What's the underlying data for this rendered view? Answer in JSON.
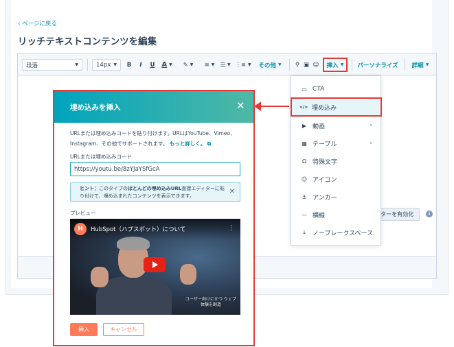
{
  "header": {
    "back_link": "‹ ページに戻る",
    "page_title": "リッチテキストコンテンツを編集"
  },
  "toolbar": {
    "paragraph_select": "段落",
    "font_size_select": "14px",
    "bold": "B",
    "italic": "I",
    "underline": "U",
    "text_color": "A",
    "highlight": "✎",
    "align": "≡",
    "bullet_list": "☰",
    "numbered_list": "⋮≡",
    "more_label": "その他",
    "link_icon": "⚲",
    "image_icon": "▣",
    "emoji_icon": "☺",
    "insert_label": "挿入",
    "personalize_label": "パーソナライズ",
    "details_label": "詳細"
  },
  "insert_menu": {
    "items": [
      {
        "label": "CTA",
        "icon": "cta-icon",
        "glyph": "▭"
      },
      {
        "label": "埋め込み",
        "icon": "embed-icon",
        "glyph": "</>"
      },
      {
        "label": "動画",
        "icon": "video-icon",
        "glyph": "▶"
      },
      {
        "label": "テーブル",
        "icon": "table-icon",
        "glyph": "▦"
      },
      {
        "label": "特殊文字",
        "icon": "omega-icon",
        "glyph": "Ω"
      },
      {
        "label": "アイコン",
        "icon": "emoji-icon",
        "glyph": "☺"
      },
      {
        "label": "アンカー",
        "icon": "anchor-icon",
        "glyph": "⚓"
      },
      {
        "label": "横線",
        "icon": "horizontal-rule-icon",
        "glyph": "—"
      },
      {
        "label": "ノーブレークスペース",
        "icon": "nbsp-icon",
        "glyph": "⤓"
      }
    ]
  },
  "editor_footer": {
    "dark_editor_button": "ダークエディターを有効化",
    "info_icon": "i"
  },
  "modal": {
    "title": "埋め込みを挿入",
    "close_icon": "✕",
    "description": "URLまたは埋め込みコードを貼り付けます。URLはYouTube、Vimeo、Instagram、その他でサポートされます。",
    "learn_more": "もっと詳しく。",
    "external_icon": "⧉",
    "url_label": "URLまたは埋め込みコード",
    "url_value": "https://youtu.be/8zYJaYSfGcA",
    "hint_prefix": "ヒント：",
    "hint_middle": "このタイプの",
    "hint_bold": "ほとんどの埋め込みURL",
    "hint_rest": "直接エディターに貼り付けて、埋め込まれたコンテンツを表示できます。",
    "hint_close": "✕",
    "preview_label": "プレビュー",
    "video": {
      "logo": "H",
      "title": "HubSpot（ハブスポット）について",
      "kebab": "⋮",
      "subtitle": "ユーザー向けにかつ ウェブ体験を創造"
    },
    "insert_button": "挿入",
    "cancel_button": "キャンセル"
  },
  "colors": {
    "accent_teal": "#0091ae",
    "highlight_red": "#e53935",
    "primary_orange": "#ff7a59",
    "header_gradient_start": "#00a4bd"
  }
}
